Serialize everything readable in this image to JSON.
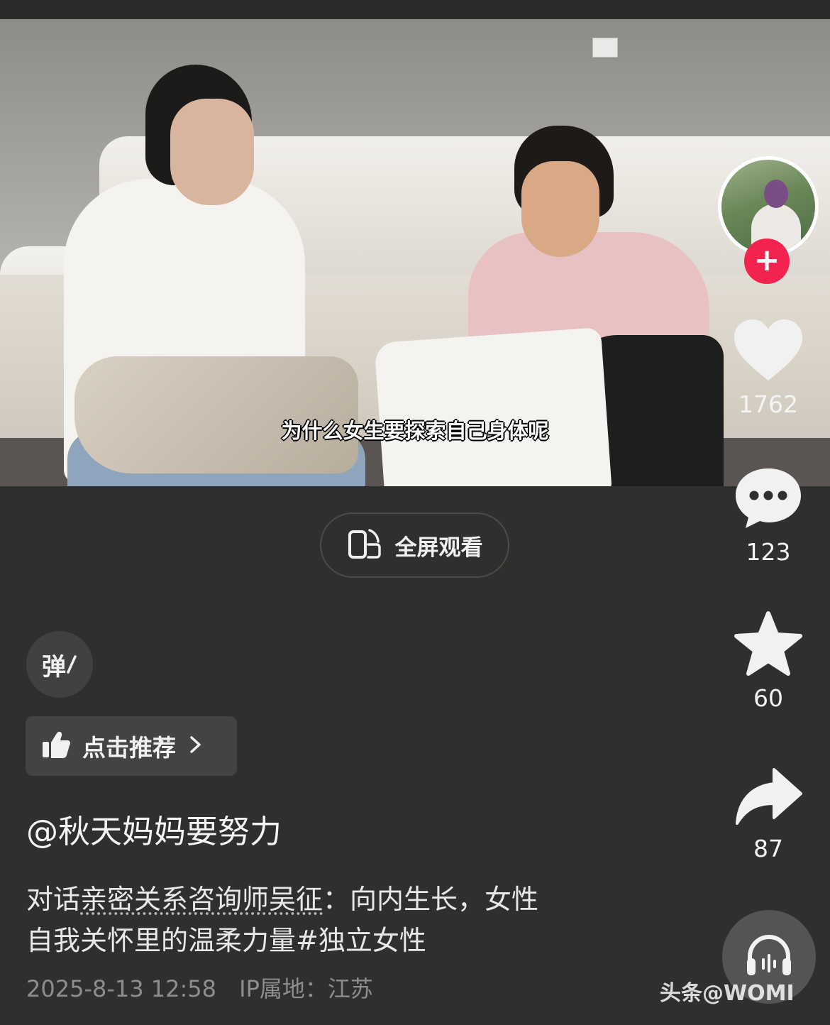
{
  "video": {
    "subtitle": "为什么女生要探索自己身体呢"
  },
  "fullscreen": {
    "label": "全屏观看",
    "icon": "rotate-phone-icon"
  },
  "danmu": {
    "label": "弹",
    "icon": "danmu-toggle-icon"
  },
  "recommend": {
    "label": "点击推荐",
    "icon": "thumbs-up-icon"
  },
  "post": {
    "author": "@秋天妈妈要努力",
    "desc_line1_prefix": "对话",
    "desc_line1_linked": "亲密关系咨询师吴征",
    "desc_line1_suffix": "：向内生长，女性",
    "desc_line2": "自我关怀里的温柔力量#独立女性",
    "datetime": "2025-8-13 12:58",
    "ip_location": "IP属地：江苏"
  },
  "sidebar": {
    "avatar_icon": "creator-avatar",
    "follow_icon": "plus-icon",
    "like": {
      "icon": "heart-icon",
      "count": "1762"
    },
    "comment": {
      "icon": "comment-bubble-icon",
      "count": "123"
    },
    "favorite": {
      "icon": "star-icon",
      "count": "60"
    },
    "share": {
      "icon": "share-arrow-icon",
      "count": "87"
    },
    "audio_icon": "headphones-icon"
  },
  "watermark": "头条@WOMI"
}
